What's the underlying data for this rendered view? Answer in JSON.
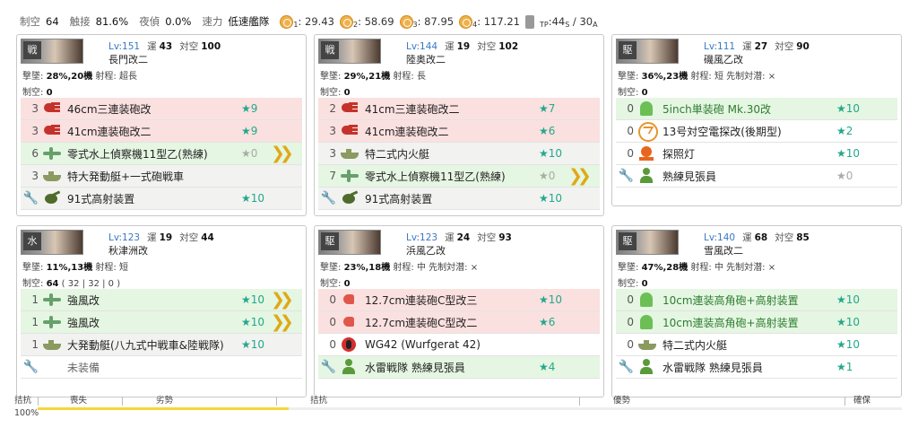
{
  "summary": {
    "air_label": "制空",
    "air": "64",
    "contact_label": "触接",
    "contact": "81.6%",
    "night_label": "夜偵",
    "night": "0.0%",
    "speed_label": "速力",
    "speed": "低速艦隊",
    "aa": [
      {
        "sub": "1",
        "val": "29.43"
      },
      {
        "sub": "2",
        "val": "58.69"
      },
      {
        "sub": "3",
        "val": "87.95"
      },
      {
        "sub": "4",
        "val": "117.21"
      }
    ],
    "tp_sub": "TP",
    "tp_val": "44",
    "tp_s": "S",
    "tp_sep": " / ",
    "tp_a_val": "30",
    "tp_a": "A"
  },
  "labels": {
    "luck": "運",
    "aa": "対空",
    "shootdown": "撃墜",
    "range": "射程",
    "airpower": "制空",
    "asw": "先制対潜",
    "unequipped": "未装備"
  },
  "ships": [
    {
      "id": "nagato",
      "lv": "Lv:151",
      "luck": "43",
      "aa": "100",
      "name": "長門改二",
      "portrait_tag": "戦",
      "shootdown": "28%,20機",
      "range": "超長",
      "asw": "",
      "airpower": "0",
      "airpower_detail": "",
      "slots": [
        {
          "count": "3",
          "icon": "gun",
          "bg": "red",
          "name": "46cm三連装砲改",
          "star": "★9",
          "prof": ""
        },
        {
          "count": "3",
          "icon": "gun",
          "bg": "red",
          "name": "41cm連装砲改二",
          "star": "★9",
          "prof": ""
        },
        {
          "count": "6",
          "icon": "plane",
          "bg": "green",
          "name": "零式水上偵察機11型乙(熟練)",
          "star": "★0",
          "prof": "❯❯"
        },
        {
          "count": "3",
          "icon": "boat",
          "bg": "gray",
          "name": "特大発動艇+一式砲戦車",
          "star": "",
          "prof": ""
        },
        {
          "count": "",
          "icon": "aagun",
          "bg": "gray",
          "wrench": true,
          "name": "91式高射装置",
          "star": "★10",
          "prof": ""
        }
      ]
    },
    {
      "id": "mutsu",
      "lv": "Lv:144",
      "luck": "19",
      "aa": "102",
      "name": "陸奥改二",
      "portrait_tag": "戦",
      "shootdown": "29%,21機",
      "range": "長",
      "asw": "",
      "airpower": "0",
      "airpower_detail": "",
      "slots": [
        {
          "count": "2",
          "icon": "gun",
          "bg": "red",
          "name": "41cm三連装砲改二",
          "star": "★7",
          "prof": ""
        },
        {
          "count": "3",
          "icon": "gun",
          "bg": "red",
          "name": "41cm連装砲改二",
          "star": "★6",
          "prof": ""
        },
        {
          "count": "3",
          "icon": "boat",
          "bg": "gray",
          "name": "特二式内火艇",
          "star": "★10",
          "prof": ""
        },
        {
          "count": "7",
          "icon": "plane",
          "bg": "green",
          "name": "零式水上偵察機11型乙(熟練)",
          "star": "★0",
          "prof": "❯❯"
        },
        {
          "count": "",
          "icon": "aagun",
          "bg": "gray",
          "wrench": true,
          "name": "91式高射装置",
          "star": "★10",
          "prof": ""
        }
      ]
    },
    {
      "id": "isokaze",
      "lv": "Lv:111",
      "luck": "27",
      "aa": "90",
      "name": "磯風乙改",
      "portrait_tag": "駆",
      "shootdown": "36%,23機",
      "range": "短",
      "asw": "×",
      "airpower": "0",
      "airpower_detail": "",
      "slots": [
        {
          "count": "0",
          "icon": "green",
          "bg": "green",
          "name": "5inch単装砲 Mk.30改",
          "star": "★10",
          "prof": ""
        },
        {
          "count": "0",
          "icon": "radar",
          "bg": "white",
          "name": "13号対空電探改(後期型)",
          "star": "★2",
          "prof": ""
        },
        {
          "count": "0",
          "icon": "light",
          "bg": "white",
          "name": "探照灯",
          "star": "★10",
          "prof": ""
        },
        {
          "count": "",
          "icon": "crew",
          "bg": "white",
          "wrench": true,
          "name": "熟練見張員",
          "star": "★0",
          "prof": ""
        }
      ]
    },
    {
      "id": "akitsushima",
      "lv": "Lv:123",
      "luck": "19",
      "aa": "44",
      "name": "秋津洲改",
      "portrait_tag": "水",
      "shootdown": "11%,13機",
      "range": "短",
      "asw": "",
      "airpower": "64",
      "airpower_detail": "( 32 | 32 | 0 )",
      "slots": [
        {
          "count": "1",
          "icon": "plane",
          "bg": "green",
          "name": "強風改",
          "star": "★10",
          "prof": "❯❯"
        },
        {
          "count": "1",
          "icon": "plane",
          "bg": "green",
          "name": "強風改",
          "star": "★10",
          "prof": "❯❯"
        },
        {
          "count": "1",
          "icon": "boat",
          "bg": "gray",
          "name": "大発動艇(八九式中戦車&陸戦隊)",
          "star": "★10",
          "prof": ""
        },
        {
          "count": "",
          "icon": "none",
          "bg": "white",
          "wrench": true,
          "name": "未装備",
          "star": "",
          "prof": "",
          "empty": true
        }
      ]
    },
    {
      "id": "hamakaze",
      "lv": "Lv:123",
      "luck": "24",
      "aa": "93",
      "name": "浜風乙改",
      "portrait_tag": "駆",
      "shootdown": "23%,18機",
      "range": "中",
      "asw": "×",
      "airpower": "0",
      "airpower_detail": "",
      "slots": [
        {
          "count": "0",
          "icon": "pgun",
          "bg": "red",
          "name": "12.7cm連装砲C型改三",
          "star": "★10",
          "prof": ""
        },
        {
          "count": "0",
          "icon": "pgun",
          "bg": "red",
          "name": "12.7cm連装砲C型改二",
          "star": "★6",
          "prof": ""
        },
        {
          "count": "0",
          "icon": "torp",
          "bg": "white",
          "name": "WG42 (Wurfgerat 42)",
          "star": "",
          "prof": ""
        },
        {
          "count": "",
          "icon": "crew",
          "bg": "green",
          "wrench": true,
          "name": "水雷戦隊 熟練見張員",
          "star": "★4",
          "prof": ""
        }
      ]
    },
    {
      "id": "yukikaze",
      "lv": "Lv:140",
      "luck": "68",
      "aa": "85",
      "name": "雪風改二",
      "portrait_tag": "駆",
      "shootdown": "47%,28機",
      "range": "中",
      "asw": "×",
      "airpower": "0",
      "airpower_detail": "",
      "slots": [
        {
          "count": "0",
          "icon": "green",
          "bg": "green",
          "name": "10cm連装高角砲+高射装置",
          "star": "★10",
          "prof": ""
        },
        {
          "count": "0",
          "icon": "green",
          "bg": "green",
          "name": "10cm連装高角砲+高射装置",
          "star": "★10",
          "prof": ""
        },
        {
          "count": "0",
          "icon": "boat",
          "bg": "white",
          "name": "特二式内火艇",
          "star": "★10",
          "prof": ""
        },
        {
          "count": "",
          "icon": "crew",
          "bg": "white",
          "wrench": true,
          "name": "水雷戦隊 熟練見張員",
          "star": "★1",
          "prof": ""
        }
      ]
    }
  ],
  "battle": {
    "header": "拮抗",
    "labels": [
      {
        "text": "喪失"
      },
      {
        "text": "劣勢"
      },
      {
        "text": "拮抗"
      },
      {
        "text": "優勢"
      },
      {
        "text": "確保"
      }
    ],
    "percent": "100%",
    "fill_fraction": 0.29
  }
}
